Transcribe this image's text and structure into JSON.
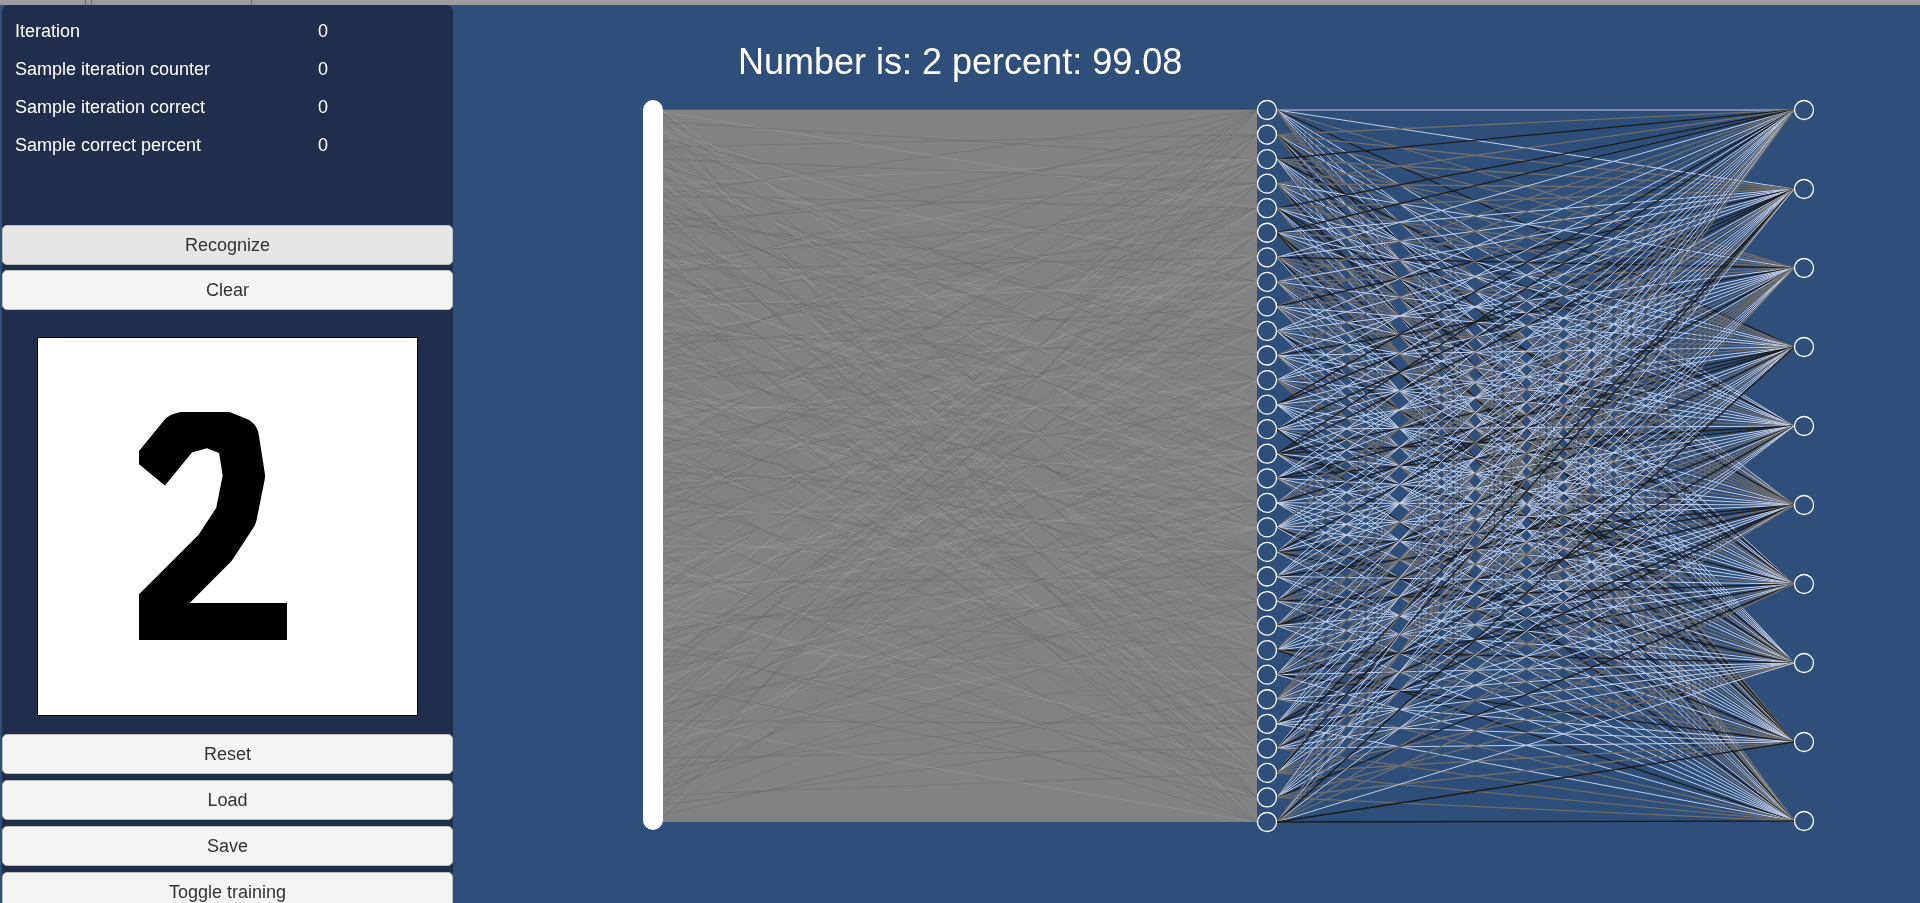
{
  "stats": [
    {
      "label": "Iteration",
      "value": "0"
    },
    {
      "label": "Sample iteration counter",
      "value": "0"
    },
    {
      "label": "Sample iteration correct",
      "value": "0"
    },
    {
      "label": "Sample correct percent",
      "value": "0"
    }
  ],
  "actions": [
    {
      "label": "Recognize",
      "highlighted": true
    },
    {
      "label": "Clear",
      "highlighted": false
    }
  ],
  "file_buttons": [
    {
      "label": "Reset",
      "highlighted": false
    },
    {
      "label": "Load",
      "highlighted": false
    },
    {
      "label": "Save",
      "highlighted": false
    },
    {
      "label": "Toggle training",
      "highlighted": false
    }
  ],
  "result": {
    "text": "Number is: 2 percent: 99.08"
  }
}
